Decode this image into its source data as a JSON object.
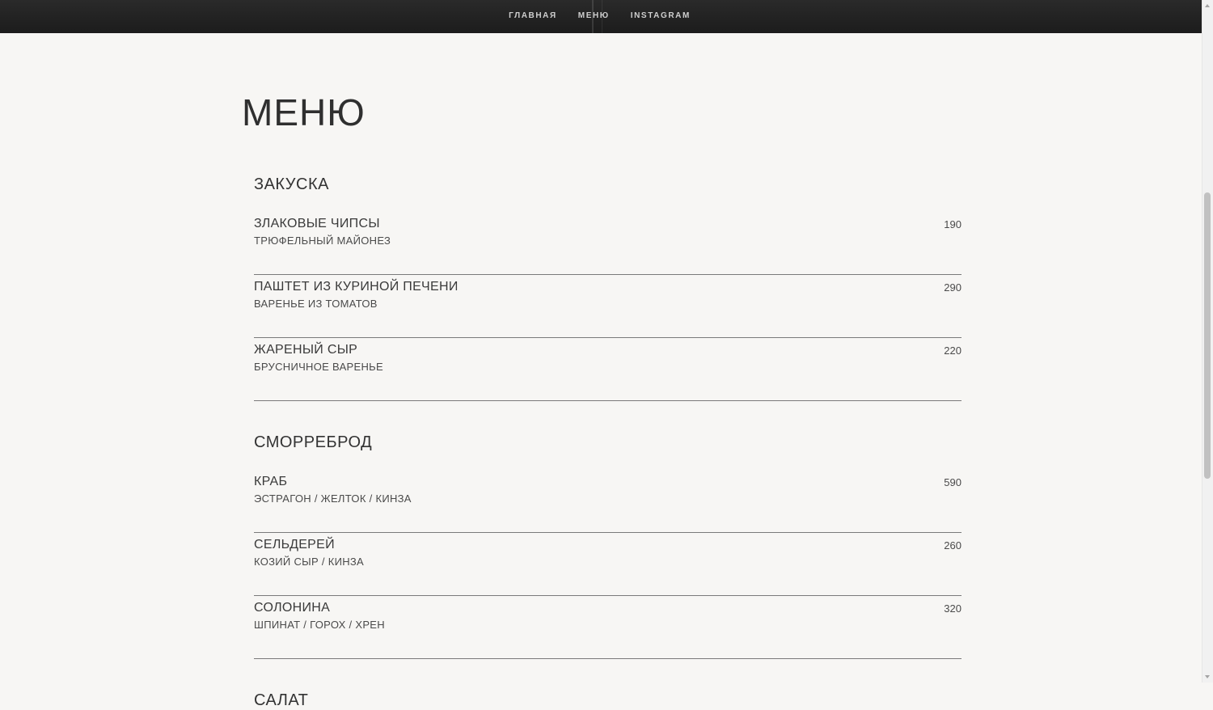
{
  "nav": {
    "items": [
      "ГЛАВНАЯ",
      "МЕНЮ",
      "INSTAGRAM"
    ]
  },
  "page_title": "МЕНЮ",
  "sections": [
    {
      "title": "ЗАКУСКА",
      "items": [
        {
          "name": "ЗЛАКОВЫЕ ЧИПСЫ",
          "desc": "ТРЮФЕЛЬНЫЙ МАЙОНЕЗ",
          "price": "190"
        },
        {
          "name": "ПАШТЕТ ИЗ КУРИНОЙ ПЕЧЕНИ",
          "desc": "ВАРЕНЬЕ ИЗ ТОМАТОВ",
          "price": "290"
        },
        {
          "name": "ЖАРЕНЫЙ СЫР",
          "desc": "БРУСНИЧНОЕ ВАРЕНЬЕ",
          "price": "220"
        }
      ]
    },
    {
      "title": "СМОРРЕБРОД",
      "items": [
        {
          "name": "КРАБ",
          "desc": "ЭСТРАГОН / ЖЕЛТОК / КИНЗА",
          "price": "590"
        },
        {
          "name": "СЕЛЬДЕРЕЙ",
          "desc": "КОЗИЙ СЫР / КИНЗА",
          "price": "260"
        },
        {
          "name": "СОЛОНИНА",
          "desc": "ШПИНАТ / ГОРОХ / ХРЕН",
          "price": "320"
        }
      ]
    },
    {
      "title": "САЛАТ",
      "items": []
    }
  ],
  "colors": {
    "background": "#f7f6f4",
    "topbar": "#1c1c1c",
    "text": "#3a3a3a",
    "divider": "#7a7a7a"
  }
}
